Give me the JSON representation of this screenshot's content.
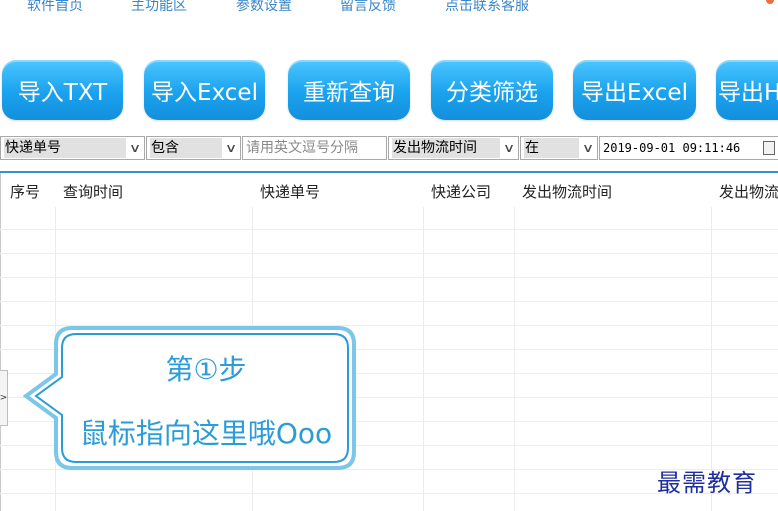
{
  "nav": {
    "items": [
      "软件首页",
      "主功能区",
      "参数设置",
      "留言反馈",
      "点击联系客服"
    ],
    "accent": "#3a86c8"
  },
  "toolbar": {
    "buttons": [
      "导入TXT",
      "导入Excel",
      "重新查询",
      "分类筛选",
      "导出Excel",
      "导出H"
    ],
    "color": "#1aa2ee"
  },
  "filter": {
    "field1": "快递单号",
    "operator1": "包含",
    "input_placeholder": "请用英文逗号分隔",
    "field2": "发出物流时间",
    "operator2": "在",
    "datetime": "2019-09-01 09:11:46"
  },
  "table": {
    "columns": [
      "序号",
      "查询时间",
      "快递单号",
      "快递公司",
      "发出物流时间",
      "发出物流"
    ]
  },
  "side_handle": {
    "glyph": ">"
  },
  "callout": {
    "step": "第①步",
    "text": "鼠标指向这里哦Ooo"
  },
  "watermark": "最需教育"
}
